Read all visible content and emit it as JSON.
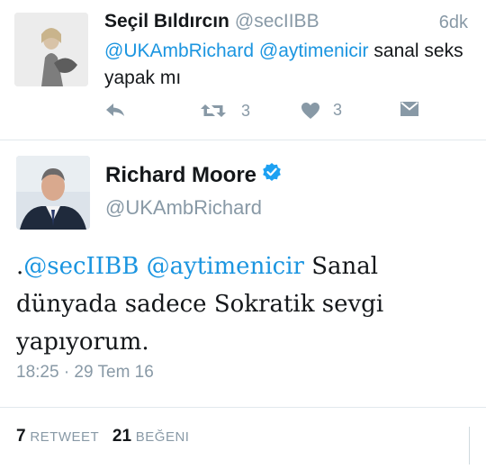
{
  "reply_tweet": {
    "display_name": "Seçil Bıldırcın",
    "handle": "@secIIBB",
    "time": "6dk",
    "mention1": "@UKAmbRichard",
    "mention2": "@aytimenicir",
    "text_rest": " sanal seks yapak mı",
    "retweet_count": "3",
    "like_count": "3",
    "icons": [
      "reply-icon",
      "retweet-icon",
      "heart-icon",
      "direct-message-icon"
    ]
  },
  "main_tweet": {
    "display_name": "Richard Moore",
    "handle": "@UKAmbRichard",
    "prefix": ".",
    "mention1": "@secIIBB",
    "mention2": "@aytimenicir",
    "text_rest": " Sanal dünyada sadece Sokratik sevgi yapıyorum.",
    "timestamp": "18:25 · 29 Tem 16",
    "retweets_count": "7",
    "retweets_label": "RETWEET",
    "likes_count": "21",
    "likes_label": "BEĞENI"
  },
  "colors": {
    "link": "#1b95e0",
    "secondary_text": "#8899a6",
    "verified": "#1da1f2"
  }
}
